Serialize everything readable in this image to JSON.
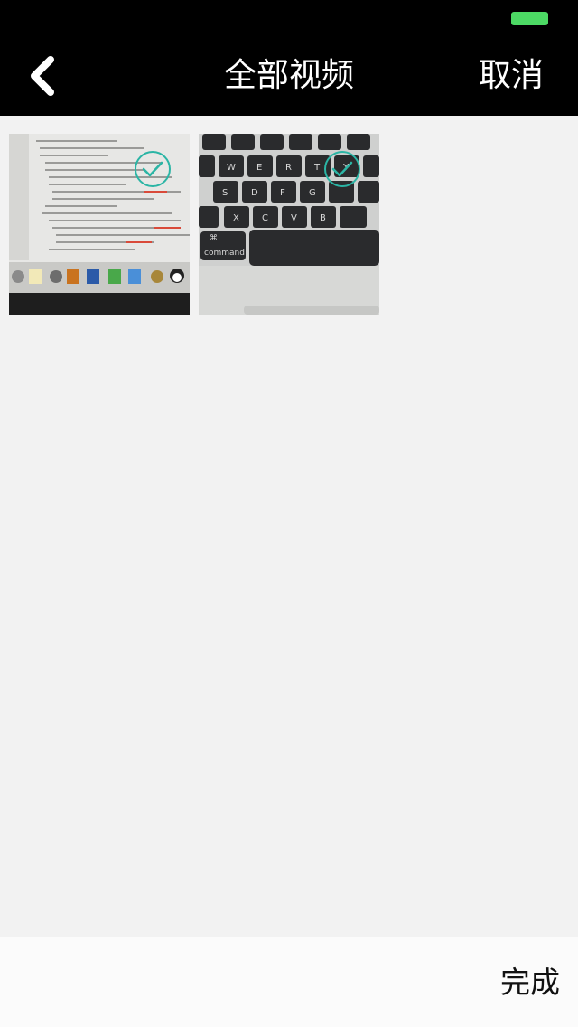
{
  "status_bar": {
    "battery_color": "#4cd964"
  },
  "nav": {
    "back_icon": "chevron-left-icon",
    "title": "全部视频",
    "cancel_label": "取消"
  },
  "videos": [
    {
      "subject": "laptop-screen-with-code",
      "selected": true
    },
    {
      "subject": "keyboard-closeup",
      "selected": true
    }
  ],
  "checkmark_color": "#2bb5a5",
  "bottom": {
    "done_label": "完成"
  }
}
